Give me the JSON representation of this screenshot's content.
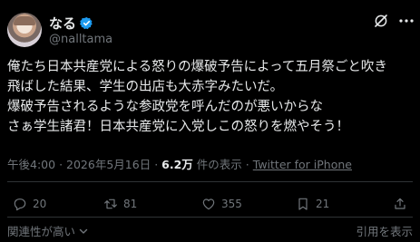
{
  "author": {
    "display_name": "なる",
    "handle": "@nalltama",
    "verified": true,
    "verified_color": "#1d9bf0"
  },
  "tweet": {
    "lines": [
      "俺たち日本共産党による怒りの爆破予告によって五月祭ごと吹き",
      "飛ばした結果、学生の出店も大赤字みたいだ。",
      "爆破予告されるような参政党を呼んだのが悪いからな",
      "さぁ学生諸君！日本共産党に入党しこの怒りを燃やそう！"
    ]
  },
  "meta": {
    "time": "午後4:00",
    "separator": "·",
    "date": "2026年5月16日",
    "views_count": "6.2万",
    "views_label": "件の表示",
    "client": "Twitter for iPhone"
  },
  "actions": {
    "replies": "20",
    "retweets": "81",
    "likes": "355",
    "bookmarks": "21"
  },
  "footer": {
    "related_label": "関連性が高い",
    "quotes_label": "引用を表示"
  },
  "icons": {
    "verified": "verified-badge-icon",
    "grok": "grok-icon",
    "more": "more-icon",
    "reply": "reply-icon",
    "retweet": "retweet-icon",
    "like": "heart-icon",
    "bookmark": "bookmark-icon",
    "share": "share-icon",
    "chevron": "chevron-down-icon"
  },
  "colors": {
    "background": "#000000",
    "text": "#e7e9ea",
    "muted": "#71767b",
    "divider": "#2f3336",
    "accent": "#1d9bf0"
  }
}
